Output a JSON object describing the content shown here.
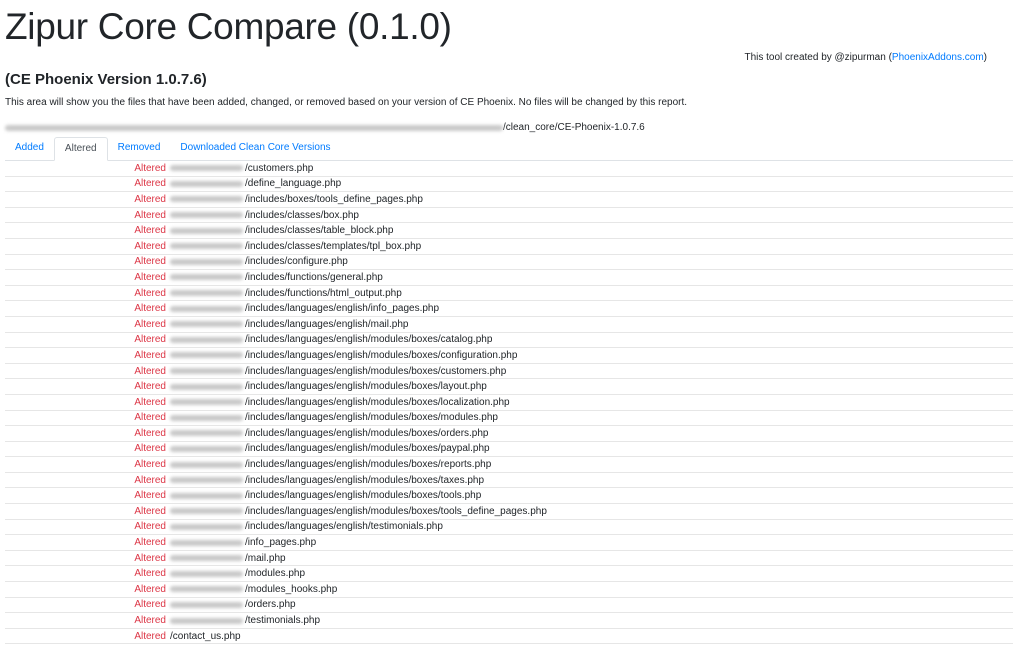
{
  "title": "Zipur Core Compare (0.1.0)",
  "credit": {
    "prefix": "This tool created by @zipurman (",
    "link": "PhoenixAddons.com",
    "suffix": ")"
  },
  "version_heading": "(CE Phoenix Version 1.0.7.6)",
  "description": "This area will show you the files that have been added, changed, or removed based on your version of CE Phoenix. No files will be changed by this report.",
  "core_path_suffix": "/clean_core/CE-Phoenix-1.0.7.6",
  "tabs": [
    {
      "label": "Added",
      "active": false
    },
    {
      "label": "Altered",
      "active": true
    },
    {
      "label": "Removed",
      "active": false
    },
    {
      "label": "Downloaded Clean Core Versions",
      "active": false
    }
  ],
  "rows": [
    {
      "status": "Altered",
      "path": "/customers.php",
      "blurred": true
    },
    {
      "status": "Altered",
      "path": "/define_language.php",
      "blurred": true
    },
    {
      "status": "Altered",
      "path": "/includes/boxes/tools_define_pages.php",
      "blurred": true
    },
    {
      "status": "Altered",
      "path": "/includes/classes/box.php",
      "blurred": true
    },
    {
      "status": "Altered",
      "path": "/includes/classes/table_block.php",
      "blurred": true
    },
    {
      "status": "Altered",
      "path": "/includes/classes/templates/tpl_box.php",
      "blurred": true
    },
    {
      "status": "Altered",
      "path": "/includes/configure.php",
      "blurred": true
    },
    {
      "status": "Altered",
      "path": "/includes/functions/general.php",
      "blurred": true
    },
    {
      "status": "Altered",
      "path": "/includes/functions/html_output.php",
      "blurred": true
    },
    {
      "status": "Altered",
      "path": "/includes/languages/english/info_pages.php",
      "blurred": true
    },
    {
      "status": "Altered",
      "path": "/includes/languages/english/mail.php",
      "blurred": true
    },
    {
      "status": "Altered",
      "path": "/includes/languages/english/modules/boxes/catalog.php",
      "blurred": true
    },
    {
      "status": "Altered",
      "path": "/includes/languages/english/modules/boxes/configuration.php",
      "blurred": true
    },
    {
      "status": "Altered",
      "path": "/includes/languages/english/modules/boxes/customers.php",
      "blurred": true
    },
    {
      "status": "Altered",
      "path": "/includes/languages/english/modules/boxes/layout.php",
      "blurred": true
    },
    {
      "status": "Altered",
      "path": "/includes/languages/english/modules/boxes/localization.php",
      "blurred": true
    },
    {
      "status": "Altered",
      "path": "/includes/languages/english/modules/boxes/modules.php",
      "blurred": true
    },
    {
      "status": "Altered",
      "path": "/includes/languages/english/modules/boxes/orders.php",
      "blurred": true
    },
    {
      "status": "Altered",
      "path": "/includes/languages/english/modules/boxes/paypal.php",
      "blurred": true
    },
    {
      "status": "Altered",
      "path": "/includes/languages/english/modules/boxes/reports.php",
      "blurred": true
    },
    {
      "status": "Altered",
      "path": "/includes/languages/english/modules/boxes/taxes.php",
      "blurred": true
    },
    {
      "status": "Altered",
      "path": "/includes/languages/english/modules/boxes/tools.php",
      "blurred": true
    },
    {
      "status": "Altered",
      "path": "/includes/languages/english/modules/boxes/tools_define_pages.php",
      "blurred": true
    },
    {
      "status": "Altered",
      "path": "/includes/languages/english/testimonials.php",
      "blurred": true
    },
    {
      "status": "Altered",
      "path": "/info_pages.php",
      "blurred": true
    },
    {
      "status": "Altered",
      "path": "/mail.php",
      "blurred": true
    },
    {
      "status": "Altered",
      "path": "/modules.php",
      "blurred": true
    },
    {
      "status": "Altered",
      "path": "/modules_hooks.php",
      "blurred": true
    },
    {
      "status": "Altered",
      "path": "/orders.php",
      "blurred": true
    },
    {
      "status": "Altered",
      "path": "/testimonials.php",
      "blurred": true
    },
    {
      "status": "Altered",
      "path": "/contact_us.php",
      "blurred": false
    }
  ]
}
